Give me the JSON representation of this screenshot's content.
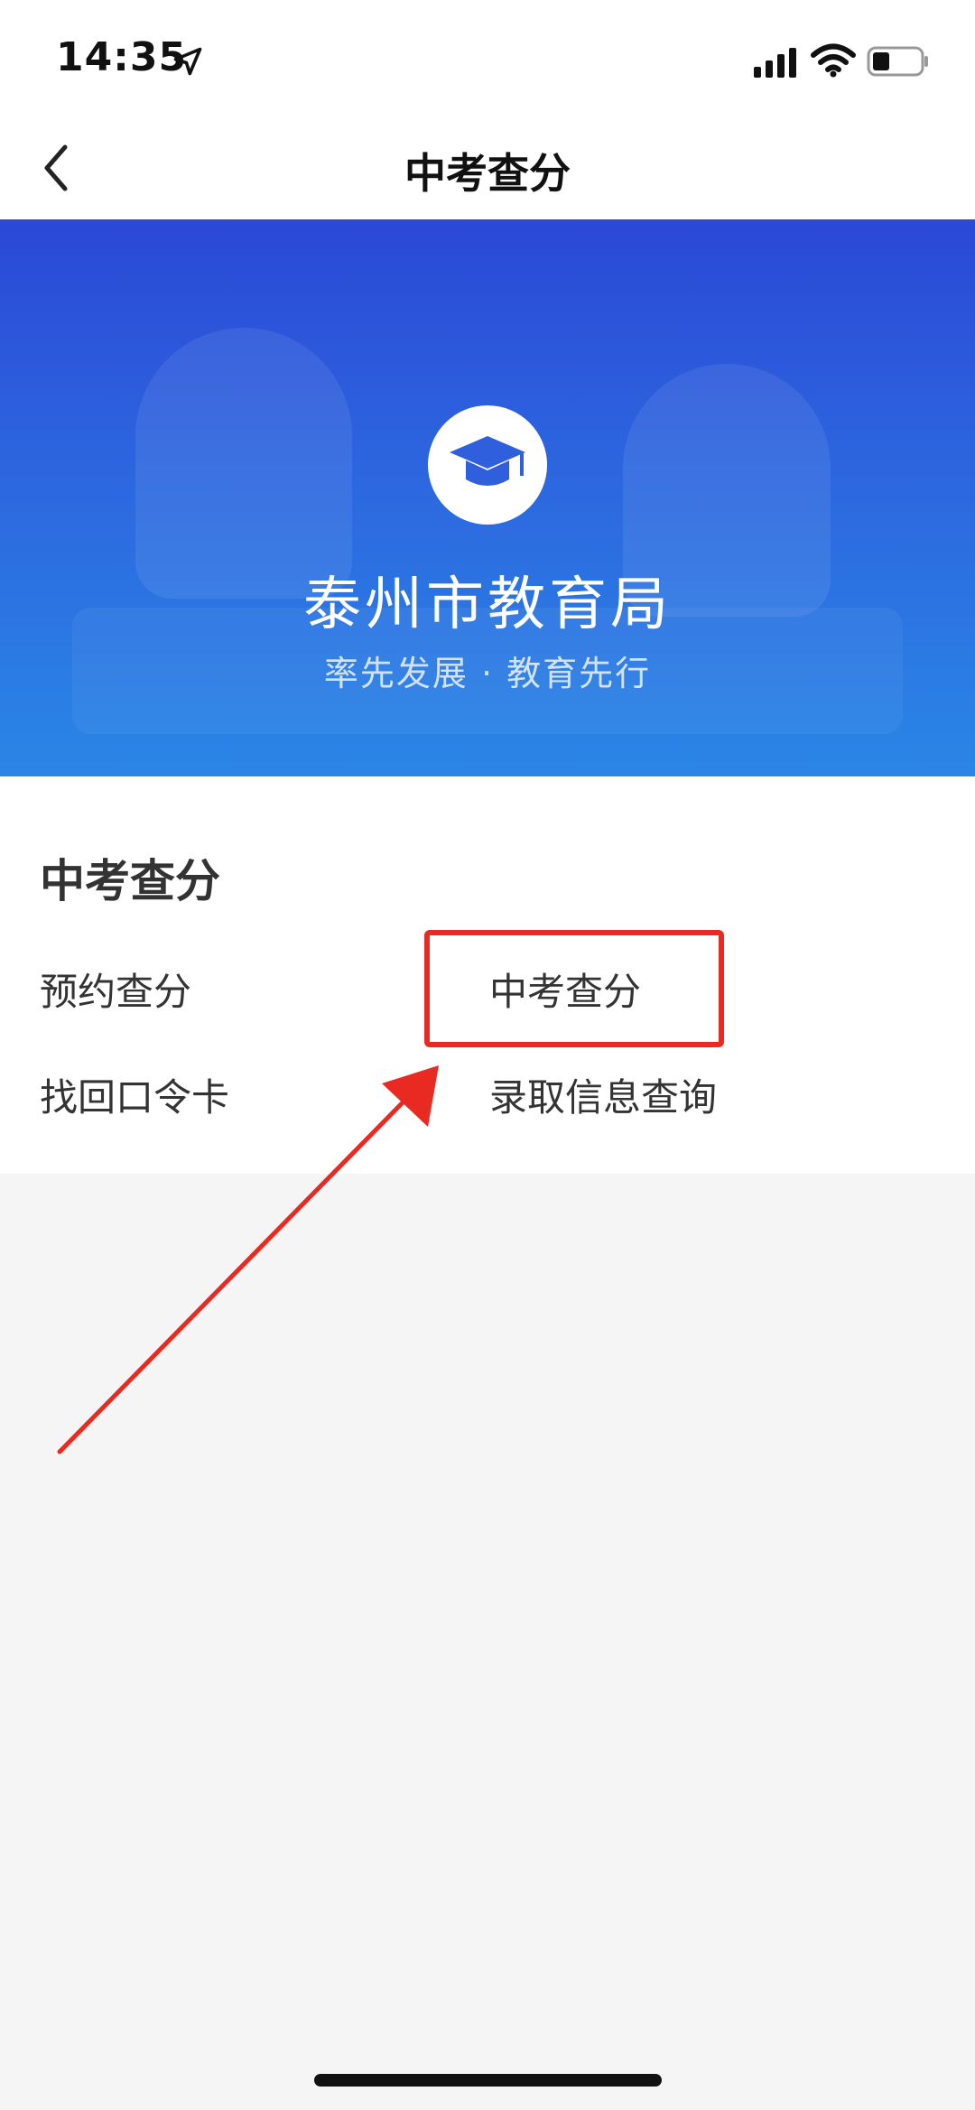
{
  "status_bar": {
    "time": "14:35",
    "icons": [
      "location-arrow-icon",
      "signal-icon",
      "wifi-icon",
      "battery-icon"
    ]
  },
  "nav": {
    "title": "中考查分",
    "back_icon": "chevron-left-icon"
  },
  "banner": {
    "logo_icon": "graduation-cap-icon",
    "title": "泰州市教育局",
    "slogan": "率先发展 · 教育先行"
  },
  "section": {
    "title": "中考查分",
    "items": [
      {
        "label": "预约查分"
      },
      {
        "label": "中考查分"
      },
      {
        "label": "找回口令卡"
      },
      {
        "label": "录取信息查询"
      }
    ]
  },
  "colors": {
    "banner_top": "#2b48d6",
    "banner_bottom": "#2a86e6",
    "annotation_red": "#e82a22",
    "page_background": "#f5f5f5"
  }
}
